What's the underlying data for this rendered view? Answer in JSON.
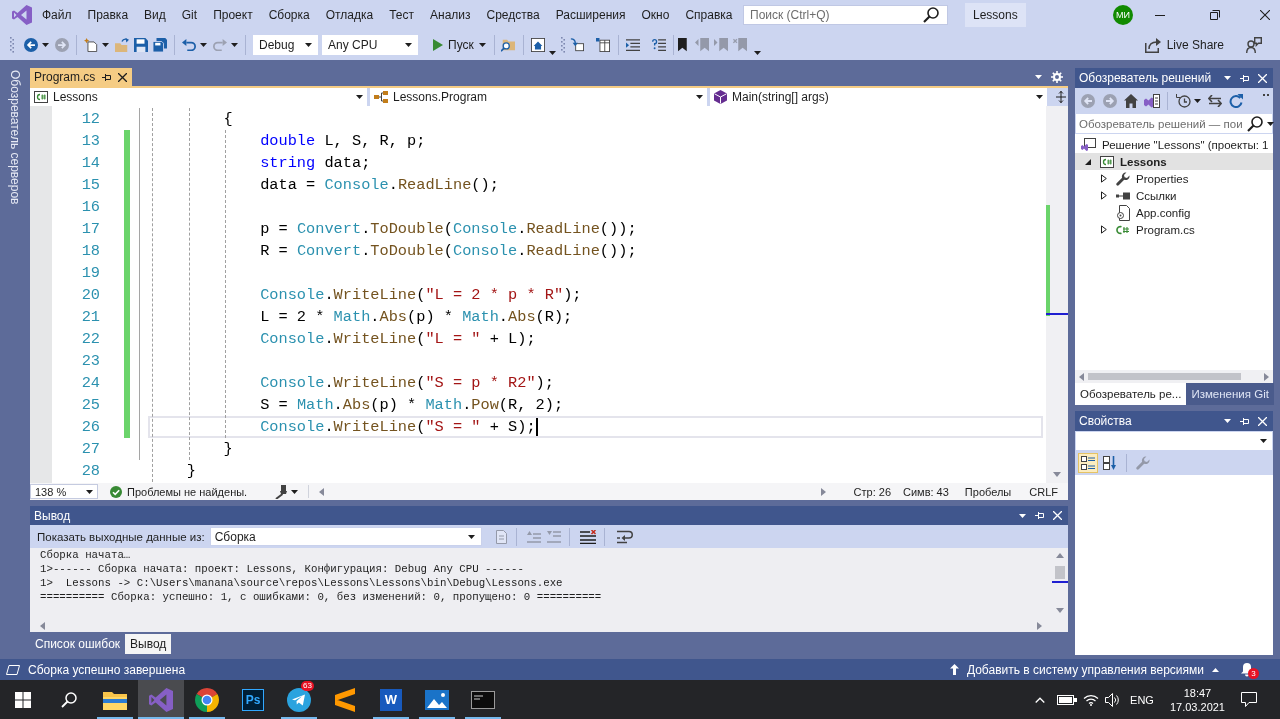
{
  "title_bar": {
    "menu": [
      "Файл",
      "Правка",
      "Вид",
      "Git",
      "Проект",
      "Сборка",
      "Отладка",
      "Тест",
      "Анализ",
      "Средства",
      "Расширения",
      "Окно",
      "Справка"
    ],
    "search": {
      "placeholder": "Поиск (Ctrl+Q)"
    },
    "solution_name": "Lessons",
    "avatar": "МИ"
  },
  "toolbar": {
    "buttons": [
      {
        "disabled": false
      },
      {
        "disabled": true
      },
      {
        "disabled": false
      },
      {
        "disabled": false
      },
      {
        "disabled": false
      },
      {
        "disabled": false
      },
      {
        "disabled": false
      },
      {
        "disabled": true
      },
      {
        "disabled": false
      },
      {
        "disabled": false
      },
      {
        "disabled": false
      },
      {
        "disabled": false
      },
      {
        "disabled": false
      },
      {
        "disabled": false
      },
      {
        "disabled": false
      },
      {
        "disabled": true
      },
      {
        "disabled": true
      },
      {
        "disabled": true
      }
    ],
    "configuration": "Debug",
    "platform": "Any CPU",
    "start": "Пуск",
    "live_share": "Live Share"
  },
  "side_tab": {
    "label": "Обозреватель серверов"
  },
  "editor": {
    "tabs": [
      {
        "label": "Program.cs",
        "selected": true
      }
    ],
    "nav": {
      "project": "Lessons",
      "type": "Lessons.Program",
      "member": "Main(string[] args)"
    },
    "lines": [
      {
        "number": "12",
        "changed": false,
        "current": false,
        "tokens": [
          {
            "kind": "plain",
            "text": "        {"
          }
        ]
      },
      {
        "number": "13",
        "changed": true,
        "current": false,
        "tokens": [
          {
            "kind": "keyword",
            "text": "            double"
          },
          {
            "kind": "plain",
            "text": " L, S, R, p;"
          }
        ]
      },
      {
        "number": "14",
        "changed": true,
        "current": false,
        "tokens": [
          {
            "kind": "keyword",
            "text": "            string"
          },
          {
            "kind": "plain",
            "text": " data;"
          }
        ]
      },
      {
        "number": "15",
        "changed": true,
        "current": false,
        "tokens": [
          {
            "kind": "plain",
            "text": "            data = "
          },
          {
            "kind": "type",
            "text": "Console"
          },
          {
            "kind": "plain",
            "text": "."
          },
          {
            "kind": "method",
            "text": "ReadLine"
          },
          {
            "kind": "plain",
            "text": "();"
          }
        ]
      },
      {
        "number": "16",
        "changed": true,
        "current": false
      },
      {
        "number": "17",
        "changed": true,
        "current": false,
        "tokens": [
          {
            "kind": "plain",
            "text": "            p = "
          },
          {
            "kind": "type",
            "text": "Convert"
          },
          {
            "kind": "plain",
            "text": "."
          },
          {
            "kind": "method",
            "text": "ToDouble"
          },
          {
            "kind": "plain",
            "text": "("
          },
          {
            "kind": "type",
            "text": "Console"
          },
          {
            "kind": "plain",
            "text": "."
          },
          {
            "kind": "method",
            "text": "ReadLine"
          },
          {
            "kind": "plain",
            "text": "());"
          }
        ]
      },
      {
        "number": "18",
        "changed": true,
        "current": false,
        "tokens": [
          {
            "kind": "plain",
            "text": "            R = "
          },
          {
            "kind": "type",
            "text": "Convert"
          },
          {
            "kind": "plain",
            "text": "."
          },
          {
            "kind": "method",
            "text": "ToDouble"
          },
          {
            "kind": "plain",
            "text": "("
          },
          {
            "kind": "type",
            "text": "Console"
          },
          {
            "kind": "plain",
            "text": "."
          },
          {
            "kind": "method",
            "text": "ReadLine"
          },
          {
            "kind": "plain",
            "text": "());"
          }
        ]
      },
      {
        "number": "19",
        "changed": true,
        "current": false
      },
      {
        "number": "20",
        "changed": true,
        "current": false,
        "tokens": [
          {
            "kind": "type",
            "text": "            Console"
          },
          {
            "kind": "plain",
            "text": "."
          },
          {
            "kind": "method",
            "text": "WriteLine"
          },
          {
            "kind": "plain",
            "text": "("
          },
          {
            "kind": "string",
            "text": "\"L = 2 * p * R\""
          },
          {
            "kind": "plain",
            "text": ");"
          }
        ]
      },
      {
        "number": "21",
        "changed": true,
        "current": false,
        "tokens": [
          {
            "kind": "plain",
            "text": "            L = 2 * "
          },
          {
            "kind": "type",
            "text": "Math"
          },
          {
            "kind": "plain",
            "text": "."
          },
          {
            "kind": "method",
            "text": "Abs"
          },
          {
            "kind": "plain",
            "text": "(p) * "
          },
          {
            "kind": "type",
            "text": "Math"
          },
          {
            "kind": "plain",
            "text": "."
          },
          {
            "kind": "method",
            "text": "Abs"
          },
          {
            "kind": "plain",
            "text": "(R);"
          }
        ]
      },
      {
        "number": "22",
        "changed": true,
        "current": false,
        "tokens": [
          {
            "kind": "type",
            "text": "            Console"
          },
          {
            "kind": "plain",
            "text": "."
          },
          {
            "kind": "method",
            "text": "WriteLine"
          },
          {
            "kind": "plain",
            "text": "("
          },
          {
            "kind": "string",
            "text": "\"L = \""
          },
          {
            "kind": "plain",
            "text": " + L);"
          }
        ]
      },
      {
        "number": "23",
        "changed": true,
        "current": false
      },
      {
        "number": "24",
        "changed": true,
        "current": false,
        "tokens": [
          {
            "kind": "type",
            "text": "            Console"
          },
          {
            "kind": "plain",
            "text": "."
          },
          {
            "kind": "method",
            "text": "WriteLine"
          },
          {
            "kind": "plain",
            "text": "("
          },
          {
            "kind": "string",
            "text": "\"S = p * R2\""
          },
          {
            "kind": "plain",
            "text": ");"
          }
        ]
      },
      {
        "number": "25",
        "changed": true,
        "current": false,
        "tokens": [
          {
            "kind": "plain",
            "text": "            S = "
          },
          {
            "kind": "type",
            "text": "Math"
          },
          {
            "kind": "plain",
            "text": "."
          },
          {
            "kind": "method",
            "text": "Abs"
          },
          {
            "kind": "plain",
            "text": "(p) * "
          },
          {
            "kind": "type",
            "text": "Math"
          },
          {
            "kind": "plain",
            "text": "."
          },
          {
            "kind": "method",
            "text": "Pow"
          },
          {
            "kind": "plain",
            "text": "(R, 2);"
          }
        ]
      },
      {
        "number": "26",
        "changed": true,
        "current": true,
        "tokens": [
          {
            "kind": "type",
            "text": "            Console"
          },
          {
            "kind": "plain",
            "text": "."
          },
          {
            "kind": "method",
            "text": "WriteLine"
          },
          {
            "kind": "plain",
            "text": "("
          },
          {
            "kind": "string",
            "text": "\"S = \""
          },
          {
            "kind": "plain",
            "text": " + S);"
          }
        ]
      },
      {
        "number": "27",
        "changed": false,
        "current": false,
        "tokens": [
          {
            "kind": "plain",
            "text": "        }"
          }
        ]
      },
      {
        "number": "28",
        "changed": false,
        "current": false,
        "tokens": [
          {
            "kind": "plain",
            "text": "    }"
          }
        ]
      }
    ],
    "zoom": "138 %",
    "issues": "Проблемы не найдены.",
    "line": "Стр: 26",
    "column": "Симв: 43",
    "spacing": "Пробелы",
    "line_ending": "CRLF"
  },
  "output": {
    "title": "Вывод",
    "source_label": "Показать выходные данные из:",
    "source": "Сборка",
    "buttons": [
      {
        "disabled": true
      },
      {
        "disabled": true
      },
      {
        "disabled": true
      },
      {
        "disabled": false
      },
      {
        "disabled": false
      }
    ],
    "lines": [
      "Сборка начата…",
      "1>------ Сборка начата: проект: Lessons, Конфигурация: Debug Any CPU ------",
      "1>  Lessons -> C:\\Users\\manana\\source\\repos\\Lessons\\Lessons\\bin\\Debug\\Lessons.exe",
      "========== Сборка: успешно: 1, с ошибками: 0, без изменений: 0, пропущено: 0 =========="
    ],
    "tabs": [
      {
        "label": "Список ошибок",
        "selected": false
      },
      {
        "label": "Вывод",
        "selected": true
      }
    ]
  },
  "solution_explorer": {
    "title": "Обозреватель решений",
    "buttons": [
      {
        "disabled": true
      },
      {
        "disabled": true
      },
      {
        "disabled": false
      },
      {
        "disabled": false
      },
      {
        "disabled": false
      },
      {
        "disabled": false
      },
      {
        "disabled": false
      }
    ],
    "search": {
      "placeholder": "Обозреватель решений — пои"
    },
    "tree": [
      {
        "label": "Решение \"Lessons\" (проекты: 1",
        "kind": "solution",
        "selected": false,
        "children": [
          {
            "label": "Lessons",
            "kind": "project",
            "expandable": true,
            "expanded": true,
            "selected": true,
            "children": [
              {
                "label": "Properties",
                "kind": "properties",
                "expandable": true,
                "expanded": false,
                "selected": false
              },
              {
                "label": "Ссылки",
                "kind": "references",
                "expandable": true,
                "expanded": false,
                "selected": false
              },
              {
                "label": "App.config",
                "kind": "config",
                "expandable": false,
                "expanded": false,
                "selected": false
              },
              {
                "label": "Program.cs",
                "kind": "code_file",
                "expandable": true,
                "expanded": false,
                "selected": false
              }
            ]
          }
        ]
      }
    ],
    "tabs": [
      {
        "label": "Обозреватель ре...",
        "selected": true
      },
      {
        "label": "Изменения Git",
        "selected": false
      }
    ]
  },
  "properties": {
    "title": "Свойства",
    "buttons": [
      {
        "selected": true,
        "disabled": false
      },
      {
        "selected": false,
        "disabled": false
      },
      {
        "selected": false,
        "disabled": true
      }
    ]
  },
  "status_bar": {
    "message": "Сборка успешно завершена",
    "source_control": "Добавить в систему управления версиями",
    "notifications": "3"
  },
  "taskbar": {
    "apps": [
      {
        "active": false,
        "running": true
      },
      {
        "active": true,
        "running": true
      },
      {
        "active": false,
        "running": true
      },
      {
        "active": false,
        "running": false,
        "label": "Ps"
      },
      {
        "active": false,
        "running": true,
        "badge": "63"
      },
      {
        "active": false,
        "running": false
      },
      {
        "active": false,
        "running": true,
        "label": "W"
      },
      {
        "active": false,
        "running": true
      },
      {
        "active": false,
        "running": true
      }
    ],
    "language": "ENG",
    "time": "18:47",
    "date": "17.03.2021"
  }
}
